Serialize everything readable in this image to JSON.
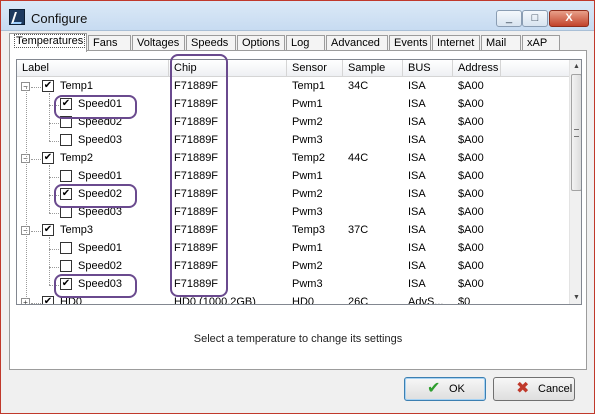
{
  "window": {
    "title": "Configure",
    "controls": [
      "_",
      "□",
      "X"
    ]
  },
  "tabs": [
    "Temperatures",
    "Fans",
    "Voltages",
    "Speeds",
    "Options",
    "Log",
    "Advanced",
    "Events",
    "Internet",
    "Mail",
    "xAP"
  ],
  "active_tab": "Temperatures",
  "columns": [
    "Label",
    "Chip",
    "Sensor",
    "Sample",
    "BUS",
    "Address"
  ],
  "rows": [
    {
      "label": "Temp1",
      "chip": "F71889F",
      "sensor": "Temp1",
      "sample": "34C",
      "bus": "ISA",
      "address": "$A00",
      "level": 0,
      "expander": "-",
      "checked": true
    },
    {
      "label": "Speed01",
      "chip": "F71889F",
      "sensor": "Pwm1",
      "sample": "",
      "bus": "ISA",
      "address": "$A00",
      "level": 1,
      "checked": true
    },
    {
      "label": "Speed02",
      "chip": "F71889F",
      "sensor": "Pwm2",
      "sample": "",
      "bus": "ISA",
      "address": "$A00",
      "level": 1,
      "checked": false
    },
    {
      "label": "Speed03",
      "chip": "F71889F",
      "sensor": "Pwm3",
      "sample": "",
      "bus": "ISA",
      "address": "$A00",
      "level": 1,
      "checked": false
    },
    {
      "label": "Temp2",
      "chip": "F71889F",
      "sensor": "Temp2",
      "sample": "44C",
      "bus": "ISA",
      "address": "$A00",
      "level": 0,
      "expander": "-",
      "checked": true
    },
    {
      "label": "Speed01",
      "chip": "F71889F",
      "sensor": "Pwm1",
      "sample": "",
      "bus": "ISA",
      "address": "$A00",
      "level": 1,
      "checked": false
    },
    {
      "label": "Speed02",
      "chip": "F71889F",
      "sensor": "Pwm2",
      "sample": "",
      "bus": "ISA",
      "address": "$A00",
      "level": 1,
      "checked": true
    },
    {
      "label": "Speed03",
      "chip": "F71889F",
      "sensor": "Pwm3",
      "sample": "",
      "bus": "ISA",
      "address": "$A00",
      "level": 1,
      "checked": false
    },
    {
      "label": "Temp3",
      "chip": "F71889F",
      "sensor": "Temp3",
      "sample": "37C",
      "bus": "ISA",
      "address": "$A00",
      "level": 0,
      "expander": "-",
      "checked": true
    },
    {
      "label": "Speed01",
      "chip": "F71889F",
      "sensor": "Pwm1",
      "sample": "",
      "bus": "ISA",
      "address": "$A00",
      "level": 1,
      "checked": false
    },
    {
      "label": "Speed02",
      "chip": "F71889F",
      "sensor": "Pwm2",
      "sample": "",
      "bus": "ISA",
      "address": "$A00",
      "level": 1,
      "checked": false
    },
    {
      "label": "Speed03",
      "chip": "F71889F",
      "sensor": "Pwm3",
      "sample": "",
      "bus": "ISA",
      "address": "$A00",
      "level": 1,
      "checked": true
    },
    {
      "label": "HD0",
      "chip": "HD0 (1000.2GB)",
      "sensor": "HD0",
      "sample": "26C",
      "bus": "AdvS...",
      "address": "$0",
      "level": 0,
      "expander": "+",
      "checked": true
    }
  ],
  "status_text": "Select a temperature to change its settings",
  "buttons": {
    "ok_label": "OK",
    "cancel_label": "Cancel"
  },
  "colors": {
    "highlight": "#6a4a8e",
    "ok_icon": "#2e9e2e",
    "cancel_icon": "#c0392b"
  }
}
